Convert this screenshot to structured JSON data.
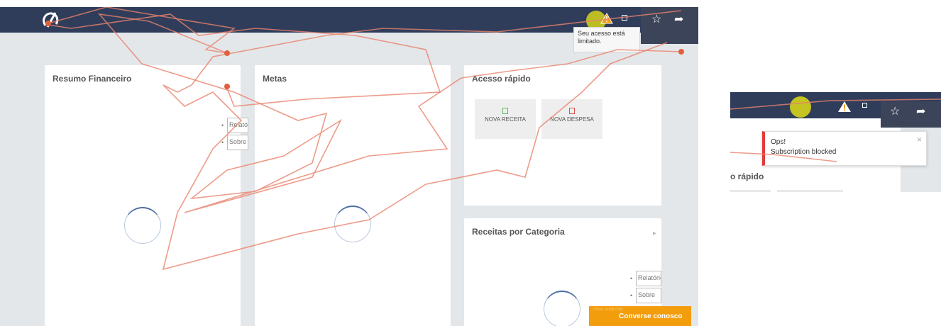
{
  "header": {
    "logo": "logo-mark",
    "tooltip": "Seu acesso está limitado.",
    "icons": [
      "warning-icon",
      "square-icon",
      "star-icon",
      "share-icon"
    ]
  },
  "panels": {
    "resumo": {
      "title": "Resumo Financeiro",
      "links": [
        "Relatório",
        "Sobre"
      ]
    },
    "metas": {
      "title": "Metas"
    },
    "acesso": {
      "title": "Acesso rápido",
      "buttons": [
        {
          "label": "NOVA RECEITA",
          "color": "#5cb85c"
        },
        {
          "label": "NOVA DESPESA",
          "color": "#d9534f"
        }
      ]
    },
    "receitas": {
      "title": "Receitas por Categoria",
      "links": [
        "Relatório",
        "Sobre"
      ]
    }
  },
  "chat": {
    "tiny": "three small dots",
    "label": "Converse conosco"
  },
  "crop": {
    "toast_title": "Ops!",
    "toast_body": "Subscription blocked",
    "close": "×",
    "partial_title": "o rápido"
  },
  "colors": {
    "topbar": "#2f3d5b",
    "accent": "#f29d0c",
    "trace": "#e8826b"
  }
}
